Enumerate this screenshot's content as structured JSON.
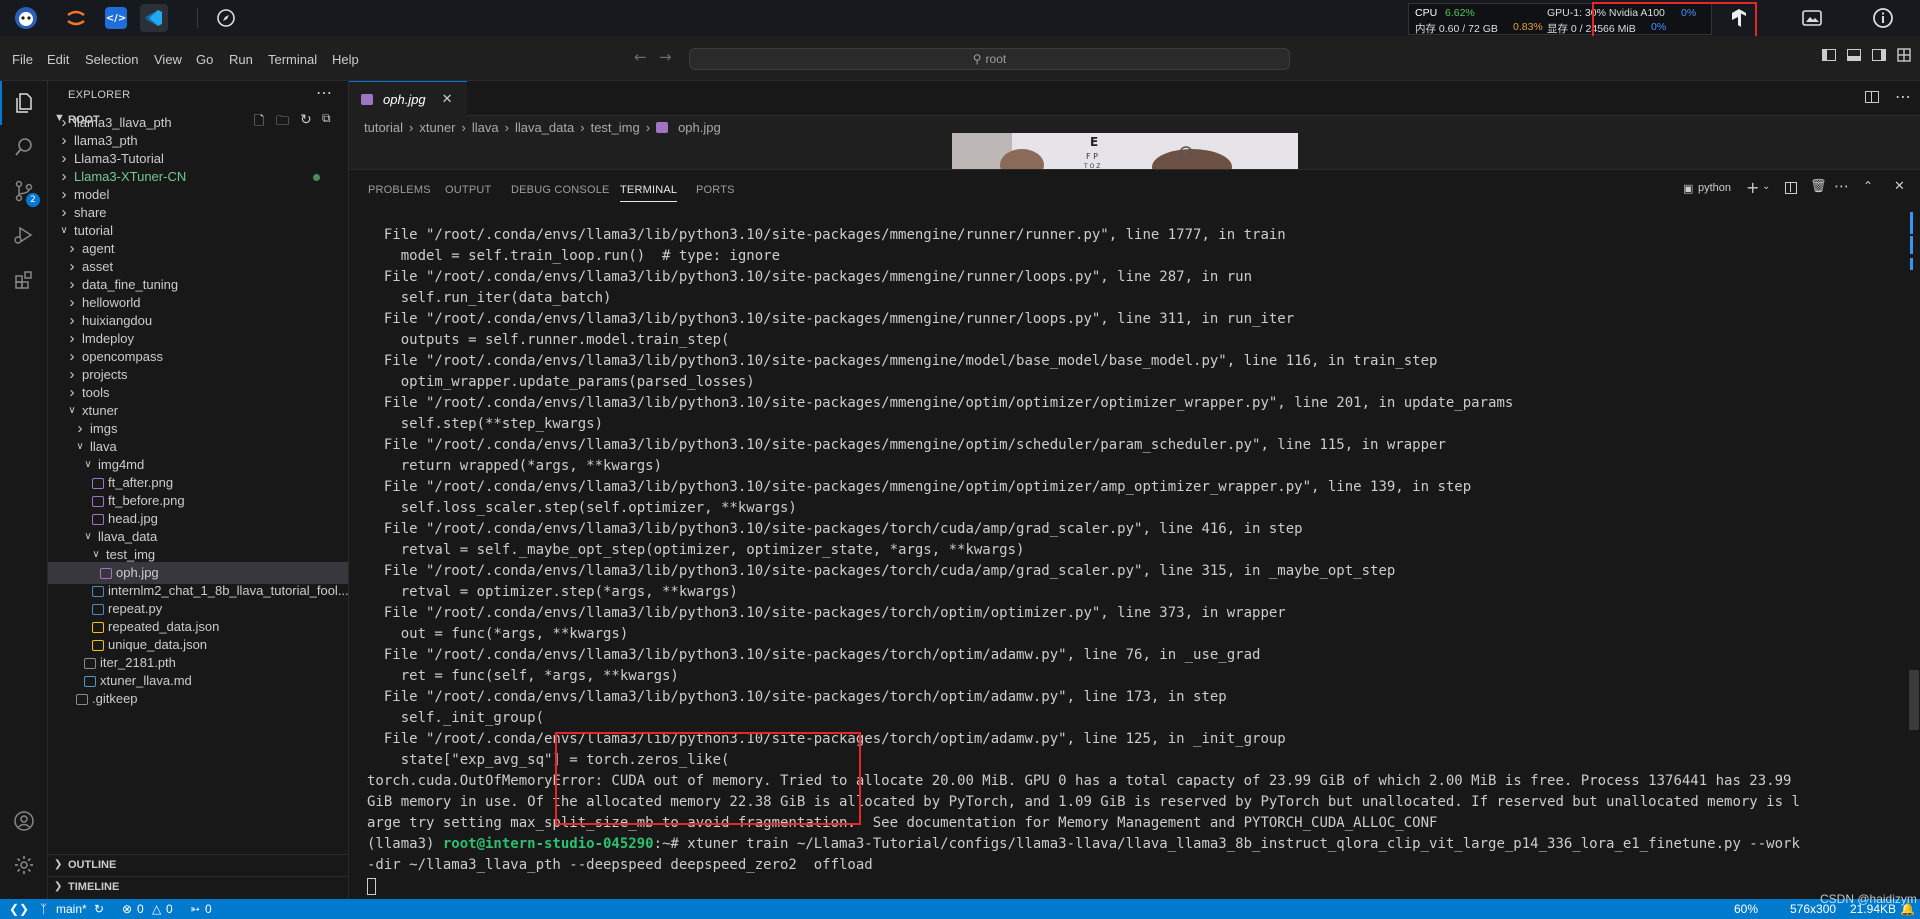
{
  "topbar": {
    "stats": {
      "cpu_label": "CPU",
      "cpu_value": "6.62%",
      "mem_label": "内存 0.60 / 72 GB",
      "mem_value": "0.83%",
      "gpu_label": "GPU-1: 30% Nvidia A100",
      "gpu_value": "0%",
      "vram_label": "显存 0 / 24566 MiB",
      "vram_value": "0%"
    }
  },
  "menubar": {
    "items": [
      "File",
      "Edit",
      "Selection",
      "View",
      "Go",
      "Run",
      "Terminal",
      "Help"
    ],
    "search_text": "root"
  },
  "activity": {
    "scm_badge": "2"
  },
  "sidebar": {
    "title": "EXPLORER",
    "root_label": "ROOT",
    "items": [
      {
        "label": "llama3_llava_pth",
        "indent": 0,
        "kind": "folder"
      },
      {
        "label": "llama3_pth",
        "indent": 0,
        "kind": "folder"
      },
      {
        "label": "Llama3-Tutorial",
        "indent": 0,
        "kind": "folder"
      },
      {
        "label": "Llama3-XTuner-CN",
        "indent": 0,
        "kind": "folder-green"
      },
      {
        "label": "model",
        "indent": 0,
        "kind": "folder"
      },
      {
        "label": "share",
        "indent": 0,
        "kind": "folder"
      },
      {
        "label": "tutorial",
        "indent": 0,
        "kind": "folder-open"
      },
      {
        "label": "agent",
        "indent": 1,
        "kind": "folder"
      },
      {
        "label": "asset",
        "indent": 1,
        "kind": "folder"
      },
      {
        "label": "data_fine_tuning",
        "indent": 1,
        "kind": "folder"
      },
      {
        "label": "helloworld",
        "indent": 1,
        "kind": "folder"
      },
      {
        "label": "huixiangdou",
        "indent": 1,
        "kind": "folder"
      },
      {
        "label": "lmdeploy",
        "indent": 1,
        "kind": "folder"
      },
      {
        "label": "opencompass",
        "indent": 1,
        "kind": "folder"
      },
      {
        "label": "projects",
        "indent": 1,
        "kind": "folder"
      },
      {
        "label": "tools",
        "indent": 1,
        "kind": "folder"
      },
      {
        "label": "xtuner",
        "indent": 1,
        "kind": "folder-open"
      },
      {
        "label": "imgs",
        "indent": 2,
        "kind": "folder"
      },
      {
        "label": "llava",
        "indent": 2,
        "kind": "folder-open"
      },
      {
        "label": "img4md",
        "indent": 3,
        "kind": "folder-open"
      },
      {
        "label": "ft_after.png",
        "indent": 4,
        "kind": "image"
      },
      {
        "label": "ft_before.png",
        "indent": 4,
        "kind": "image"
      },
      {
        "label": "head.jpg",
        "indent": 4,
        "kind": "image"
      },
      {
        "label": "llava_data",
        "indent": 3,
        "kind": "folder-open"
      },
      {
        "label": "test_img",
        "indent": 4,
        "kind": "folder-open"
      },
      {
        "label": "oph.jpg",
        "indent": 5,
        "kind": "image",
        "selected": true
      },
      {
        "label": "internlm2_chat_1_8b_llava_tutorial_fool...",
        "indent": 4,
        "kind": "python"
      },
      {
        "label": "repeat.py",
        "indent": 4,
        "kind": "python"
      },
      {
        "label": "repeated_data.json",
        "indent": 4,
        "kind": "json"
      },
      {
        "label": "unique_data.json",
        "indent": 4,
        "kind": "json"
      },
      {
        "label": "iter_2181.pth",
        "indent": 3,
        "kind": "file"
      },
      {
        "label": "xtuner_llava.md",
        "indent": 3,
        "kind": "markdown"
      },
      {
        "label": ".gitkeep",
        "indent": 2,
        "kind": "file"
      }
    ],
    "outline_label": "OUTLINE",
    "timeline_label": "TIMELINE"
  },
  "editor": {
    "tab_label": "oph.jpg",
    "breadcrumbs": [
      "tutorial",
      "xtuner",
      "llava",
      "llava_data",
      "test_img",
      "oph.jpg"
    ]
  },
  "panel": {
    "tabs": [
      "PROBLEMS",
      "OUTPUT",
      "DEBUG CONSOLE",
      "TERMINAL",
      "PORTS"
    ],
    "active_tab": "TERMINAL",
    "shell_label": "python",
    "terminal_lines": [
      "  File \"/root/.conda/envs/llama3/lib/python3.10/site-packages/mmengine/runner/runner.py\", line 1777, in train",
      "    model = self.train_loop.run()  # type: ignore",
      "  File \"/root/.conda/envs/llama3/lib/python3.10/site-packages/mmengine/runner/loops.py\", line 287, in run",
      "    self.run_iter(data_batch)",
      "  File \"/root/.conda/envs/llama3/lib/python3.10/site-packages/mmengine/runner/loops.py\", line 311, in run_iter",
      "    outputs = self.runner.model.train_step(",
      "  File \"/root/.conda/envs/llama3/lib/python3.10/site-packages/mmengine/model/base_model/base_model.py\", line 116, in train_step",
      "    optim_wrapper.update_params(parsed_losses)",
      "  File \"/root/.conda/envs/llama3/lib/python3.10/site-packages/mmengine/optim/optimizer/optimizer_wrapper.py\", line 201, in update_params",
      "    self.step(**step_kwargs)",
      "  File \"/root/.conda/envs/llama3/lib/python3.10/site-packages/mmengine/optim/scheduler/param_scheduler.py\", line 115, in wrapper",
      "    return wrapped(*args, **kwargs)",
      "  File \"/root/.conda/envs/llama3/lib/python3.10/site-packages/mmengine/optim/optimizer/amp_optimizer_wrapper.py\", line 139, in step",
      "    self.loss_scaler.step(self.optimizer, **kwargs)",
      "  File \"/root/.conda/envs/llama3/lib/python3.10/site-packages/torch/cuda/amp/grad_scaler.py\", line 416, in step",
      "    retval = self._maybe_opt_step(optimizer, optimizer_state, *args, **kwargs)",
      "  File \"/root/.conda/envs/llama3/lib/python3.10/site-packages/torch/cuda/amp/grad_scaler.py\", line 315, in _maybe_opt_step",
      "    retval = optimizer.step(*args, **kwargs)",
      "  File \"/root/.conda/envs/llama3/lib/python3.10/site-packages/torch/optim/optimizer.py\", line 373, in wrapper",
      "    out = func(*args, **kwargs)",
      "  File \"/root/.conda/envs/llama3/lib/python3.10/site-packages/torch/optim/adamw.py\", line 76, in _use_grad",
      "    ret = func(self, *args, **kwargs)",
      "  File \"/root/.conda/envs/llama3/lib/python3.10/site-packages/torch/optim/adamw.py\", line 173, in step",
      "    self._init_group(",
      "  File \"/root/.conda/envs/llama3/lib/python3.10/site-packages/torch/optim/adamw.py\", line 125, in _init_group",
      "    state[\"exp_avg_sq\"] = torch.zeros_like(",
      "torch.cuda.OutOfMemoryError: CUDA out of memory. Tried to allocate 20.00 MiB. GPU 0 has a total capacty of 23.99 GiB of which 2.00 MiB is free. Process 1376441 has 23.99",
      "GiB memory in use. Of the allocated memory 22.38 GiB is allocated by PyTorch, and 1.09 GiB is reserved by PyTorch but unallocated. If reserved but unallocated memory is l",
      "arge try setting max_split_size_mb to avoid fragmentation.  See documentation for Memory Management and PYTORCH_CUDA_ALLOC_CONF"
    ],
    "prompt_env": "(llama3) ",
    "prompt_user": "root@intern-studio-045290",
    "prompt_cmd": ":~# xtuner train ~/Llama3-Tutorial/configs/llama3-llava/llava_llama3_8b_instruct_qlora_clip_vit_large_p14_336_lora_e1_finetune.py --work",
    "prompt_cmd2": "-dir ~/llama3_llava_pth --deepspeed deepspeed_zero2  offload"
  },
  "statusbar": {
    "branch": "main*",
    "errors": "0",
    "warnings": "0",
    "ports": "0",
    "zoom": "60%",
    "dimensions": "576x300",
    "filesize": "21.94KB",
    "watermark": "CSDN @haidizym"
  },
  "colors": {
    "accent": "#007acc",
    "annotation_red": "#e8262a",
    "folder_green": "#73c991",
    "cpu_green": "#4ec94e",
    "mem_orange": "#e5a03a",
    "gpu_blue": "#4a8fff"
  }
}
